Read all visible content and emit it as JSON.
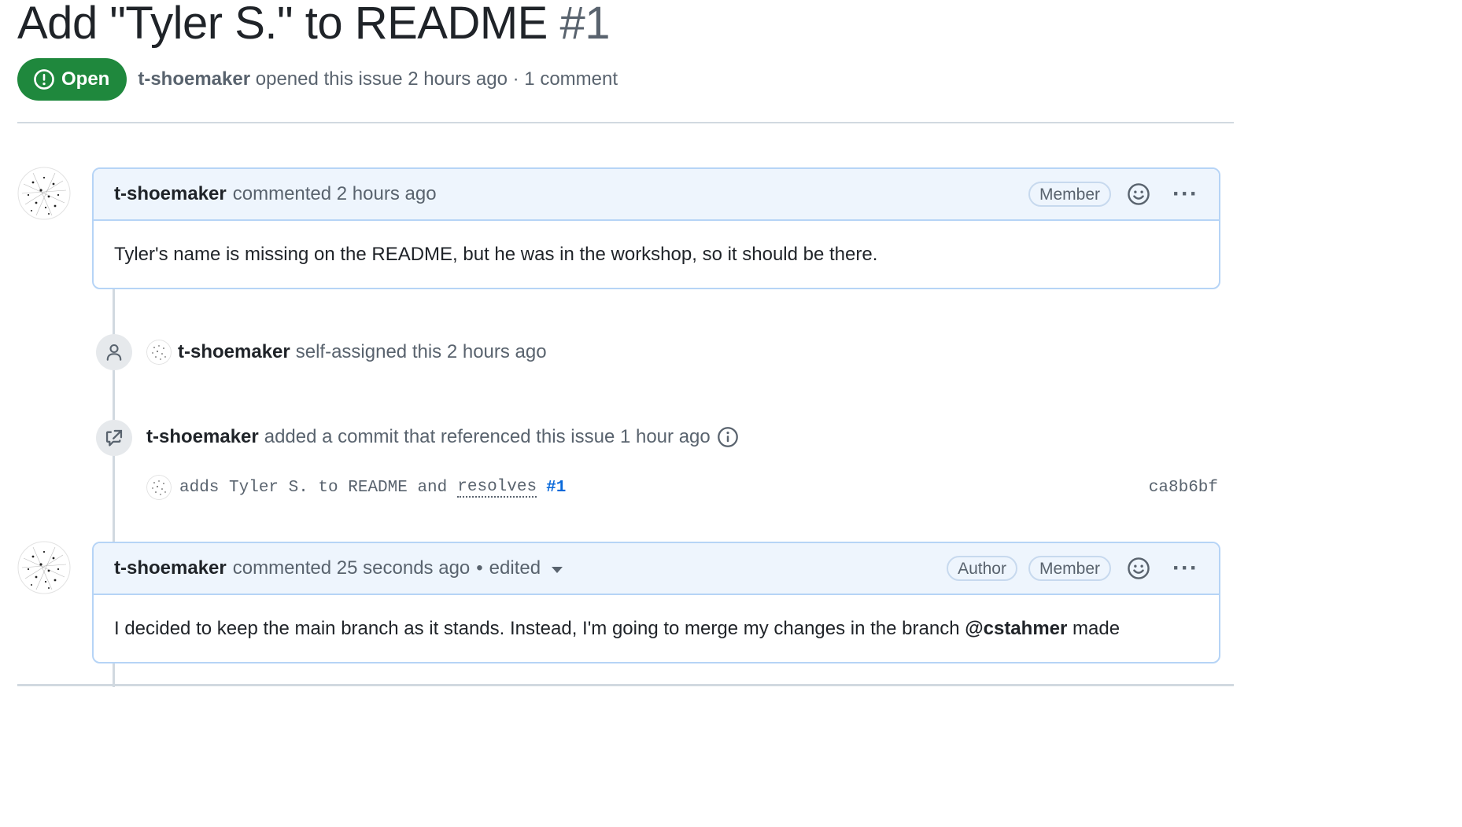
{
  "issue": {
    "title": "Add \"Tyler S.\" to README",
    "number": "#1",
    "state_label": "Open",
    "author": "t-shoemaker",
    "opened_meta": "opened this issue 2 hours ago · 1 comment",
    "state_color": "#1f883d"
  },
  "comments": [
    {
      "author": "t-shoemaker",
      "action": "commented 2 hours ago",
      "labels": [
        "Member"
      ],
      "body": "Tyler's name is missing on the README, but he was in the workshop, so it should be there."
    },
    {
      "author": "t-shoemaker",
      "action": "commented 25 seconds ago",
      "edited": "edited",
      "labels": [
        "Author",
        "Member"
      ],
      "body_prefix": "I decided to keep the main branch as it stands. Instead, I'm going to merge my changes in the branch ",
      "mention": "@cstahmer",
      "body_suffix": " made"
    }
  ],
  "events": {
    "assigned": {
      "author": "t-shoemaker",
      "text": "self-assigned this 2 hours ago"
    },
    "commit_ref": {
      "author": "t-shoemaker",
      "text": "added a commit that referenced this issue 1 hour ago",
      "commit_message": "adds Tyler S. to README and",
      "commit_keyword": "resolves",
      "commit_issue": "#1",
      "sha": "ca8b6bf"
    }
  },
  "colors": {
    "link": "#0969da",
    "header_bg": "#eef5fd",
    "border": "#b6d4f6"
  }
}
